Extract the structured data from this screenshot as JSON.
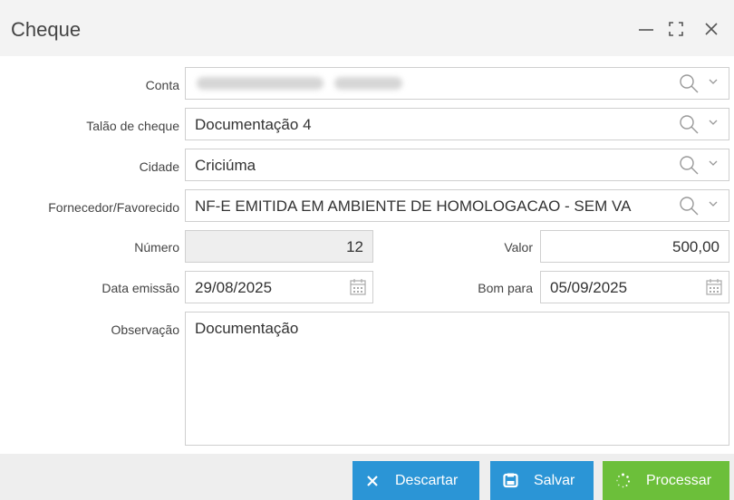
{
  "window": {
    "title": "Cheque",
    "minimize_icon": "minimize-icon",
    "maximize_icon": "maximize-icon",
    "close_icon": "close-icon"
  },
  "form": {
    "conta": {
      "label": "Conta",
      "value": ""
    },
    "talao": {
      "label": "Talão de cheque",
      "value": "Documentação 4"
    },
    "cidade": {
      "label": "Cidade",
      "value": "Criciúma"
    },
    "fornecedor": {
      "label": "Fornecedor/Favorecido",
      "value": "NF-E EMITIDA EM AMBIENTE DE HOMOLOGACAO - SEM VA"
    },
    "numero": {
      "label": "Número",
      "value": "12"
    },
    "valor": {
      "label": "Valor",
      "value": "500,00"
    },
    "data_emissao": {
      "label": "Data emissão",
      "value": "29/08/2025"
    },
    "bom_para": {
      "label": "Bom para",
      "value": "05/09/2025"
    },
    "observacao": {
      "label": "Observação",
      "value": "Documentação"
    }
  },
  "buttons": {
    "descartar": {
      "label": "Descartar",
      "color": "#2b95d6",
      "icon": "close-icon"
    },
    "salvar": {
      "label": "Salvar",
      "color": "#2b95d6",
      "icon": "save-icon"
    },
    "processar": {
      "label": "Processar",
      "color": "#6cbf3a",
      "icon": "spinner-icon"
    }
  }
}
